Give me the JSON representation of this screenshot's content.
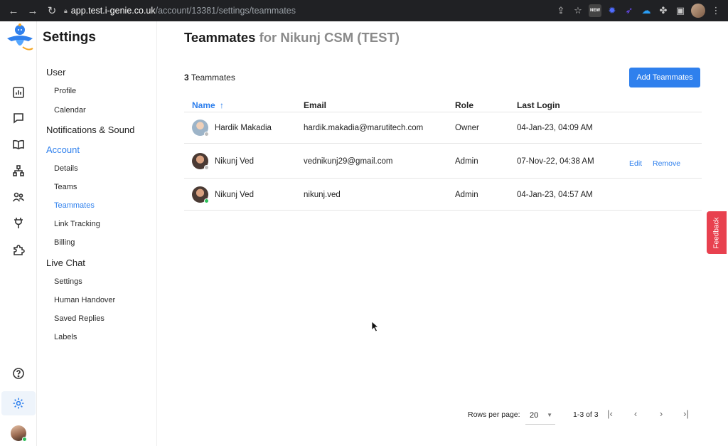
{
  "browser": {
    "url_host": "app.test.i-genie.co.uk",
    "url_path": "/account/13381/settings/teammates",
    "ext_new_label": "NEW"
  },
  "sidebar": {
    "title": "Settings",
    "sections": [
      {
        "label": "User",
        "items": [
          "Profile",
          "Calendar"
        ]
      },
      {
        "label": "Notifications & Sound",
        "items": []
      },
      {
        "label": "Account",
        "items": [
          "Details",
          "Teams",
          "Teammates",
          "Link Tracking",
          "Billing"
        ]
      },
      {
        "label": "Live Chat",
        "items": [
          "Settings",
          "Human Handover",
          "Saved Replies",
          "Labels"
        ]
      }
    ],
    "active_section": "Account",
    "active_item": "Teammates"
  },
  "main": {
    "title": "Teammates",
    "title_suffix": "for Nikunj CSM (TEST)",
    "count_number": "3",
    "count_label": "Teammates",
    "add_button": "Add Teammates",
    "columns": {
      "name": "Name",
      "name_sort_icon": "↑",
      "email": "Email",
      "role": "Role",
      "last_login": "Last Login"
    },
    "rows": [
      {
        "name": "Hardik Makadia",
        "email": "hardik.makadia@marutitech.com",
        "role": "Owner",
        "last_login": "04-Jan-23, 04:09 AM",
        "status_color": "#bdbdbd"
      },
      {
        "name": "Nikunj Ved",
        "email": "vednikunj29@gmail.com",
        "role": "Admin",
        "last_login": "07-Nov-22, 04:38 AM",
        "status_color": "#bdbdbd",
        "edit": "Edit",
        "remove": "Remove"
      },
      {
        "name": "Nikunj Ved",
        "email": "nikunj.ved",
        "role": "Admin",
        "last_login": "04-Jan-23, 04:57 AM",
        "status_color": "#2ec05b"
      }
    ],
    "pagination": {
      "rows_per_page_label": "Rows per page:",
      "rows_per_page": "20",
      "range": "1-3 of 3"
    }
  },
  "feedback": {
    "label": "Feedback"
  },
  "colors": {
    "accent": "#2f80ed",
    "feedback": "#e8414f",
    "online": "#2ec05b"
  }
}
